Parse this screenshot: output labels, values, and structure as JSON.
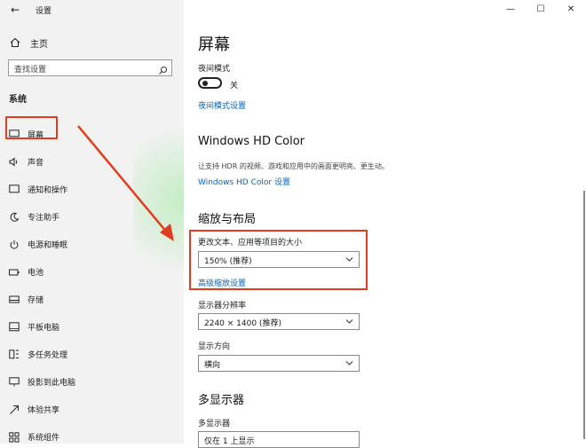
{
  "window": {
    "title": "设置",
    "controls": [
      "—",
      "☐",
      "✕"
    ]
  },
  "sidebar": {
    "home_label": "主页",
    "search_placeholder": "查找设置",
    "section": "系统",
    "items": [
      {
        "label": "屏幕",
        "icon": "monitor-icon"
      },
      {
        "label": "声音",
        "icon": "speaker-icon"
      },
      {
        "label": "通知和操作",
        "icon": "notification-icon"
      },
      {
        "label": "专注助手",
        "icon": "moon-icon"
      },
      {
        "label": "电源和睡眠",
        "icon": "power-icon"
      },
      {
        "label": "电池",
        "icon": "battery-icon"
      },
      {
        "label": "存储",
        "icon": "storage-icon"
      },
      {
        "label": "平板电脑",
        "icon": "tablet-icon"
      },
      {
        "label": "多任务处理",
        "icon": "multitask-icon"
      },
      {
        "label": "投影到此电脑",
        "icon": "project-icon"
      },
      {
        "label": "体验共享",
        "icon": "share-icon"
      },
      {
        "label": "系统组件",
        "icon": "components-icon"
      }
    ]
  },
  "main": {
    "title": "屏幕",
    "night_mode": {
      "label": "夜间模式",
      "state": "关",
      "link": "夜间模式设置"
    },
    "hdr": {
      "heading": "Windows HD Color",
      "desc": "让支持 HDR 的视频、游戏和应用中的画面更明亮、更生动。",
      "link": "Windows HD Color 设置"
    },
    "scale": {
      "heading": "缩放与布局",
      "size_label": "更改文本、应用等项目的大小",
      "size_value": "150% (推荐)",
      "advanced_link": "高级缩放设置",
      "resolution_label": "显示器分辨率",
      "resolution_value": "2240 × 1400 (推荐)",
      "orientation_label": "显示方向",
      "orientation_value": "横向"
    },
    "multi": {
      "heading": "多显示器",
      "label": "多显示器",
      "value": "仅在 1 上显示"
    }
  },
  "colors": {
    "accent": "#0a64b4",
    "annotation": "#e23c1f"
  }
}
